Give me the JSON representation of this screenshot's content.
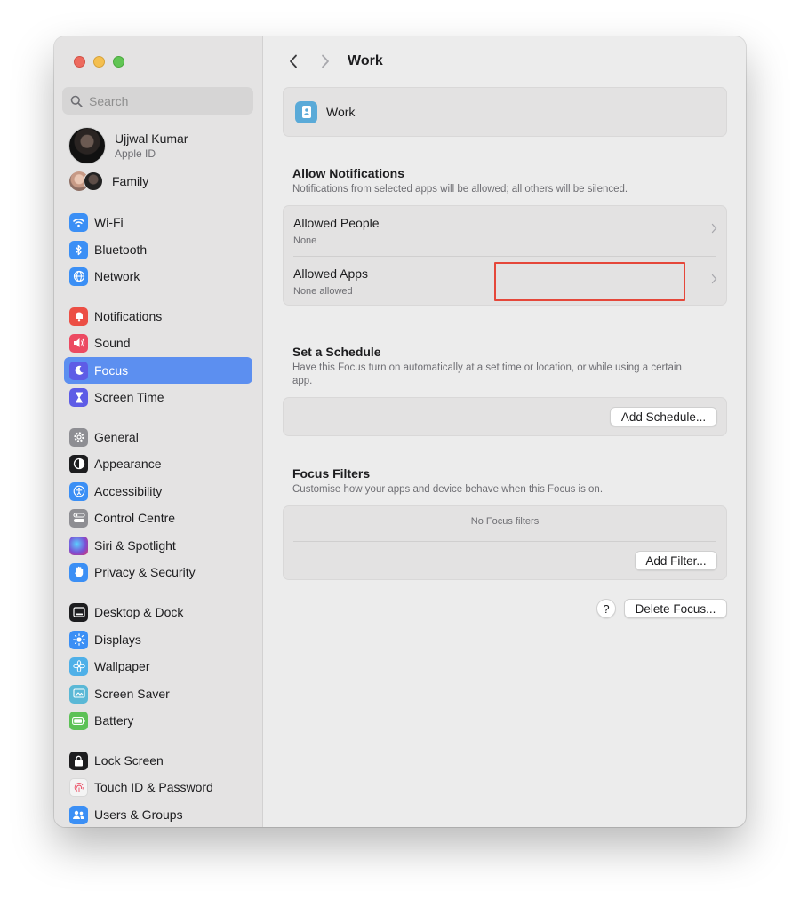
{
  "sidebar": {
    "search_placeholder": "Search",
    "profile": {
      "name": "Ujjwal Kumar",
      "subtitle": "Apple ID"
    },
    "family_label": "Family",
    "items": [
      {
        "label": "Wi-Fi",
        "icon": "wifi-icon",
        "color": "#3b8ff5"
      },
      {
        "label": "Bluetooth",
        "icon": "bluetooth-icon",
        "color": "#3b8ff5"
      },
      {
        "label": "Network",
        "icon": "globe-icon",
        "color": "#3b8ff5"
      },
      {
        "label": "Notifications",
        "icon": "bell-icon",
        "color": "#ec4f45"
      },
      {
        "label": "Sound",
        "icon": "speaker-icon",
        "color": "#ec4a62"
      },
      {
        "label": "Focus",
        "icon": "moon-icon",
        "color": "#5e5ce6",
        "active": true
      },
      {
        "label": "Screen Time",
        "icon": "hourglass-icon",
        "color": "#5e5ce6"
      },
      {
        "label": "General",
        "icon": "gear-icon",
        "color": "#8e8e93"
      },
      {
        "label": "Appearance",
        "icon": "appearance-icon",
        "color": "#1d1d1f"
      },
      {
        "label": "Accessibility",
        "icon": "accessibility-icon",
        "color": "#3b8ff5"
      },
      {
        "label": "Control Centre",
        "icon": "control-centre-icon",
        "color": "#8e8e93"
      },
      {
        "label": "Siri & Spotlight",
        "icon": "siri-icon",
        "color": "#7a4fd6"
      },
      {
        "label": "Privacy & Security",
        "icon": "hand-icon",
        "color": "#3b8ff5"
      },
      {
        "label": "Desktop & Dock",
        "icon": "dock-icon",
        "color": "#1d1d1f"
      },
      {
        "label": "Displays",
        "icon": "sun-icon",
        "color": "#3b8ff5"
      },
      {
        "label": "Wallpaper",
        "icon": "flower-icon",
        "color": "#4fb0e8"
      },
      {
        "label": "Screen Saver",
        "icon": "screen-saver-icon",
        "color": "#5ab8d6"
      },
      {
        "label": "Battery",
        "icon": "battery-icon",
        "color": "#5cc156"
      },
      {
        "label": "Lock Screen",
        "icon": "lock-icon",
        "color": "#1d1d1f"
      },
      {
        "label": "Touch ID & Password",
        "icon": "fingerprint-icon",
        "color": "#f0f0f0"
      },
      {
        "label": "Users & Groups",
        "icon": "users-icon",
        "color": "#3b8ff5"
      }
    ]
  },
  "main": {
    "title": "Work",
    "focus_name": "Work",
    "allow_notifications": {
      "title": "Allow Notifications",
      "description": "Notifications from selected apps will be allowed; all others will be silenced.",
      "rows": [
        {
          "title": "Allowed People",
          "subtitle": "None"
        },
        {
          "title": "Allowed Apps",
          "subtitle": "None allowed"
        }
      ]
    },
    "schedule": {
      "title": "Set a Schedule",
      "description": "Have this Focus turn on automatically at a set time or location, or while using a certain app.",
      "button": "Add Schedule..."
    },
    "filters": {
      "title": "Focus Filters",
      "description": "Customise how your apps and device behave when this Focus is on.",
      "empty": "No Focus filters",
      "button": "Add Filter..."
    },
    "help": "?",
    "delete": "Delete Focus..."
  }
}
